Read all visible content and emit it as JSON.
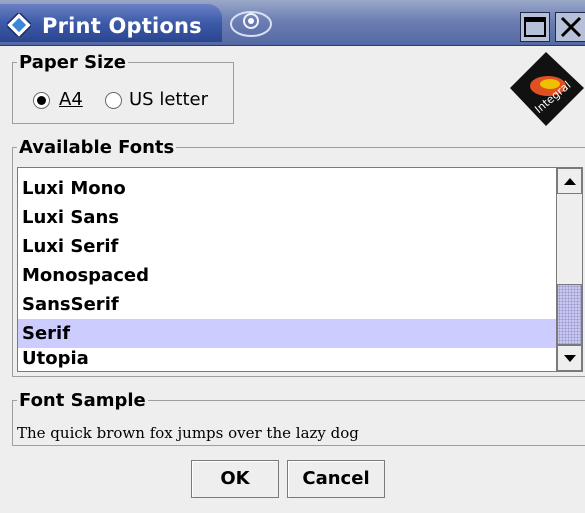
{
  "window": {
    "title": "Print Options"
  },
  "paper_size": {
    "legend": "Paper Size",
    "options": [
      {
        "label": "A4",
        "selected": true
      },
      {
        "label": "US letter",
        "selected": false
      }
    ]
  },
  "fonts": {
    "legend": "Available Fonts",
    "items": [
      "Luxi Mono",
      "Luxi Sans",
      "Luxi Serif",
      "Monospaced",
      "SansSerif",
      "Serif",
      "Utopia"
    ],
    "selected": "Serif"
  },
  "sample": {
    "legend": "Font Sample",
    "text": "The quick brown fox jumps over the lazy dog"
  },
  "buttons": {
    "ok": "OK",
    "cancel": "Cancel"
  },
  "logo": {
    "text": "Integral",
    "colors": [
      "#e05020",
      "#f0c000",
      "#111111"
    ]
  },
  "colors": {
    "title_bar": "#3c5aa8",
    "selection": "#ccccff",
    "background": "#eeeeee"
  }
}
